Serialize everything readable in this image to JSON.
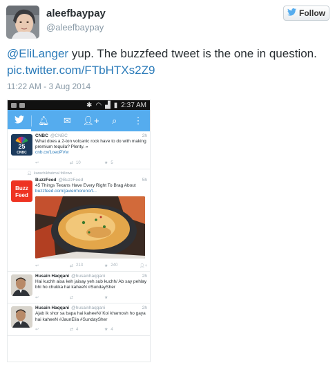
{
  "tweet": {
    "display_name": "aleefbaypay",
    "handle": "@aleefbaypay",
    "follow_label": "Follow",
    "text_mention": "@EliLanger",
    "text_body": " yup. The buzzfeed tweet is the one in question. ",
    "text_link": "pic.twitter.com/FTbHTXs2Z9",
    "timestamp": "11:22 AM - 3 Aug 2014"
  },
  "screenshot": {
    "status_time": "2:37 AM",
    "items": [
      {
        "name": "CNBC",
        "handle": "@CNBC",
        "time": "2h",
        "text": "What does a 2-ton volcanic rock have to do with making premium tequila? Plenty. »",
        "link": "cnb.cx/1oeoPVw",
        "retweets": "10",
        "favorites": "5"
      },
      {
        "follows_note": "karachikhatmal follows",
        "name": "BuzzFeed",
        "handle": "@BuzzFeed",
        "time": "5h",
        "text": "45 Things Texans Have Every Right To Brag About",
        "link": "buzzfeed.com/javiermoreno/t...",
        "retweets": "213",
        "favorites": "240"
      },
      {
        "name": "Husain Haqqani",
        "handle": "@husainhaqqani",
        "time": "2h",
        "text": "Hai kuchh aisa keh jaisay yeh sub kuchh/ Ab say pehlay bhi ho chukka hai kaheeN #SundaySher"
      },
      {
        "name": "Husain Haqqani",
        "handle": "@husainhaqqani",
        "time": "2h",
        "text": "Ajab ik shor sa bapa hai kaheeN/ Koi khamosh ho gaya hai kaheeN #JaunElia #SundaySher",
        "retweets": "4",
        "favorites": "4"
      }
    ]
  },
  "colors": {
    "twitter_blue": "#55acee",
    "link": "#2b7bb9",
    "muted": "#8899a6",
    "cnbc_bg": "#1b3a5c",
    "buzzfeed_red": "#ee3322"
  }
}
